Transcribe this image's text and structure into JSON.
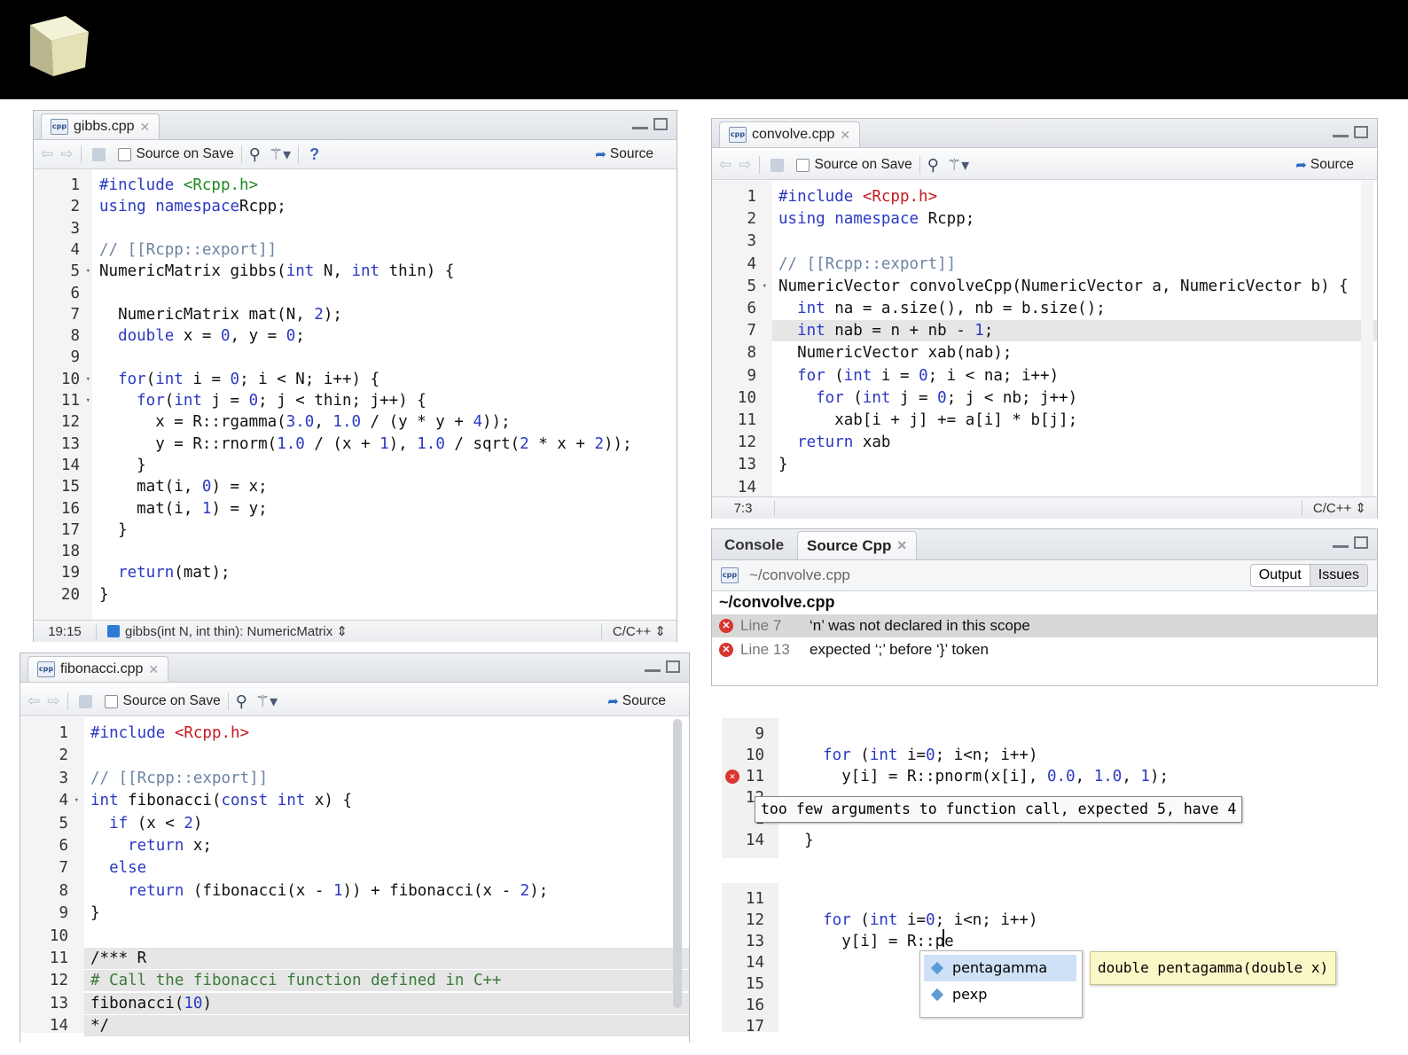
{
  "colors": {
    "keyword": "#2a39c3",
    "string_green": "#1b8a22",
    "string_red": "#c7191f",
    "comment": "#6b84a3"
  },
  "toolbar": {
    "source_on_save": "Source on Save",
    "source": "Source",
    "help": "?"
  },
  "gibbs": {
    "tab": "gibbs.cpp",
    "status": {
      "pos": "19:15",
      "fn": "gibbs(int N, int thin): NumericMatrix ⇕",
      "lang": "C/C++ ⇕"
    },
    "lines": [
      {
        "n": "1",
        "s": [
          [
            "pp",
            "#include "
          ],
          [
            "str",
            "<Rcpp.h>"
          ]
        ]
      },
      {
        "n": "2",
        "s": [
          [
            "kw",
            "using namespace"
          ],
          [
            "",
            "Rcpp;"
          ]
        ]
      },
      {
        "n": "3",
        "s": []
      },
      {
        "n": "4",
        "s": [
          [
            "cm",
            "// [[Rcpp::export]]"
          ]
        ]
      },
      {
        "n": "5",
        "f": true,
        "s": [
          [
            "",
            "NumericMatrix gibbs("
          ],
          [
            "kw",
            "int"
          ],
          [
            "",
            " N, "
          ],
          [
            "kw",
            "int"
          ],
          [
            "",
            " thin) {"
          ]
        ]
      },
      {
        "n": "6",
        "s": []
      },
      {
        "n": "7",
        "s": [
          [
            "",
            "  NumericMatrix mat(N, "
          ],
          [
            "num",
            "2"
          ],
          [
            "",
            ");"
          ]
        ]
      },
      {
        "n": "8",
        "s": [
          [
            "kw",
            "  double"
          ],
          [
            "",
            " x = "
          ],
          [
            "num",
            "0"
          ],
          [
            "",
            ", y = "
          ],
          [
            "num",
            "0"
          ],
          [
            "",
            ";"
          ]
        ]
      },
      {
        "n": "9",
        "s": []
      },
      {
        "n": "10",
        "f": true,
        "s": [
          [
            "kw",
            "  for"
          ],
          [
            "",
            "("
          ],
          [
            "kw",
            "int"
          ],
          [
            "",
            " i = "
          ],
          [
            "num",
            "0"
          ],
          [
            "",
            "; i < N; i++) {"
          ]
        ]
      },
      {
        "n": "11",
        "f": true,
        "s": [
          [
            "kw",
            "    for"
          ],
          [
            "",
            "("
          ],
          [
            "kw",
            "int"
          ],
          [
            "",
            " j = "
          ],
          [
            "num",
            "0"
          ],
          [
            "",
            "; j < thin; j++) {"
          ]
        ]
      },
      {
        "n": "12",
        "s": [
          [
            "",
            "      x = R::rgamma("
          ],
          [
            "num",
            "3.0"
          ],
          [
            "",
            ", "
          ],
          [
            "num",
            "1.0"
          ],
          [
            "",
            " / (y * y + "
          ],
          [
            "num",
            "4"
          ],
          [
            "",
            "));"
          ]
        ]
      },
      {
        "n": "13",
        "s": [
          [
            "",
            "      y = R::rnorm("
          ],
          [
            "num",
            "1.0"
          ],
          [
            "",
            " / (x + "
          ],
          [
            "num",
            "1"
          ],
          [
            "",
            "), "
          ],
          [
            "num",
            "1.0"
          ],
          [
            "",
            " / sqrt("
          ],
          [
            "num",
            "2"
          ],
          [
            "",
            " * x + "
          ],
          [
            "num",
            "2"
          ],
          [
            "",
            "));"
          ]
        ]
      },
      {
        "n": "14",
        "s": [
          [
            "",
            "    }"
          ]
        ]
      },
      {
        "n": "15",
        "s": [
          [
            "",
            "    mat(i, "
          ],
          [
            "num",
            "0"
          ],
          [
            "",
            ") = x;"
          ]
        ]
      },
      {
        "n": "16",
        "s": [
          [
            "",
            "    mat(i, "
          ],
          [
            "num",
            "1"
          ],
          [
            "",
            ") = y;"
          ]
        ]
      },
      {
        "n": "17",
        "s": [
          [
            "",
            "  }"
          ]
        ]
      },
      {
        "n": "18",
        "s": []
      },
      {
        "n": "19",
        "s": [
          [
            "kw",
            "  return"
          ],
          [
            "",
            "(mat);"
          ]
        ]
      },
      {
        "n": "20",
        "s": [
          [
            "",
            "}"
          ]
        ]
      }
    ]
  },
  "convolve": {
    "tab": "convolve.cpp",
    "status": {
      "pos": "7:3",
      "lang": "C/C++ ⇕"
    },
    "lines": [
      {
        "n": "1",
        "s": [
          [
            "kw",
            "#include "
          ],
          [
            "strr",
            "<Rcpp.h>"
          ]
        ]
      },
      {
        "n": "2",
        "s": [
          [
            "kw",
            "using namespace"
          ],
          [
            "",
            " Rcpp;"
          ]
        ]
      },
      {
        "n": "3",
        "s": []
      },
      {
        "n": "4",
        "s": [
          [
            "cm",
            "// [[Rcpp::export]]"
          ]
        ]
      },
      {
        "n": "5",
        "f": true,
        "s": [
          [
            "",
            "NumericVector convolveCpp(NumericVector a, NumericVector b) {"
          ]
        ]
      },
      {
        "n": "6",
        "s": [
          [
            "kw",
            "  int"
          ],
          [
            "",
            " na = a.size(), nb = b.size();"
          ]
        ]
      },
      {
        "n": "7",
        "hl": true,
        "s": [
          [
            "kw",
            "  int"
          ],
          [
            "",
            " nab = n + nb - "
          ],
          [
            "num",
            "1"
          ],
          [
            "",
            ";"
          ]
        ]
      },
      {
        "n": "8",
        "s": [
          [
            "",
            "  NumericVector xab(nab);"
          ]
        ]
      },
      {
        "n": "9",
        "s": [
          [
            "kw",
            "  for"
          ],
          [
            "",
            " ("
          ],
          [
            "kw",
            "int"
          ],
          [
            "",
            " i = "
          ],
          [
            "num",
            "0"
          ],
          [
            "",
            "; i < na; i++)"
          ]
        ]
      },
      {
        "n": "10",
        "s": [
          [
            "kw",
            "    for"
          ],
          [
            "",
            " ("
          ],
          [
            "kw",
            "int"
          ],
          [
            "",
            " j = "
          ],
          [
            "num",
            "0"
          ],
          [
            "",
            "; j < nb; j++)"
          ]
        ]
      },
      {
        "n": "11",
        "s": [
          [
            "",
            "      xab[i + j] += a[i] * b[j];"
          ]
        ]
      },
      {
        "n": "12",
        "s": [
          [
            "kw",
            "  return"
          ],
          [
            "",
            " xab"
          ]
        ]
      },
      {
        "n": "13",
        "s": [
          [
            "",
            "}"
          ]
        ]
      },
      {
        "n": "14",
        "s": []
      }
    ]
  },
  "console": {
    "tabs": [
      "Console",
      "Source Cpp"
    ],
    "path": "~/convolve.cpp",
    "buttons": [
      "Output",
      "Issues"
    ],
    "file": "~/convolve.cpp",
    "issues": [
      {
        "line": "Line 7",
        "msg": "‘n’ was not declared in this scope"
      },
      {
        "line": "Line 13",
        "msg": "expected ‘;’ before ‘}’ token"
      }
    ]
  },
  "fibonacci": {
    "tab": "fibonacci.cpp",
    "lines": [
      {
        "n": "1",
        "s": [
          [
            "kw",
            "#include "
          ],
          [
            "strr",
            "<Rcpp.h>"
          ]
        ]
      },
      {
        "n": "2",
        "s": []
      },
      {
        "n": "3",
        "s": [
          [
            "cm",
            "// [[Rcpp::export]]"
          ]
        ]
      },
      {
        "n": "4",
        "f": true,
        "s": [
          [
            "kw",
            "int"
          ],
          [
            "",
            " fibonacci("
          ],
          [
            "kw",
            "const int"
          ],
          [
            "",
            " x) {"
          ]
        ]
      },
      {
        "n": "5",
        "s": [
          [
            "kw",
            "  if"
          ],
          [
            "",
            " (x < "
          ],
          [
            "num",
            "2"
          ],
          [
            "",
            ")"
          ]
        ]
      },
      {
        "n": "6",
        "s": [
          [
            "kw",
            "    return"
          ],
          [
            "",
            " x;"
          ]
        ]
      },
      {
        "n": "7",
        "s": [
          [
            "kw",
            "  else"
          ]
        ]
      },
      {
        "n": "8",
        "s": [
          [
            "kw",
            "    return"
          ],
          [
            "",
            " (fibonacci(x - "
          ],
          [
            "num",
            "1"
          ],
          [
            "",
            ")) + fibonacci(x - "
          ],
          [
            "num",
            "2"
          ],
          [
            "",
            ");"
          ]
        ]
      },
      {
        "n": "9",
        "s": [
          [
            "",
            "}"
          ]
        ]
      },
      {
        "n": "10",
        "s": []
      },
      {
        "n": "11",
        "hl": true,
        "s": [
          [
            "",
            "/*** R"
          ]
        ]
      },
      {
        "n": "12",
        "hl": true,
        "s": [
          [
            "cmg",
            "# Call the fibonacci function defined in C++"
          ]
        ]
      },
      {
        "n": "13",
        "hl": true,
        "s": [
          [
            "",
            "fibonacci("
          ],
          [
            "num",
            "10"
          ],
          [
            "",
            ")"
          ]
        ]
      },
      {
        "n": "14",
        "hl": true,
        "s": [
          [
            "",
            "*/"
          ]
        ]
      }
    ]
  },
  "snippet1": {
    "lines": [
      {
        "n": "9",
        "s": []
      },
      {
        "n": "10",
        "s": [
          [
            "kw",
            "    for"
          ],
          [
            "",
            " ("
          ],
          [
            "kw",
            "int"
          ],
          [
            "",
            " i="
          ],
          [
            "num",
            "0"
          ],
          [
            "",
            "; i<n; i++)"
          ]
        ]
      },
      {
        "n": "11",
        "e": true,
        "s": [
          [
            "",
            "      y[i] = R::pnorm(x[i], "
          ],
          [
            "num",
            "0.0"
          ],
          [
            "",
            ", "
          ],
          [
            "num",
            "1.0"
          ],
          [
            "",
            ", "
          ],
          [
            "num",
            "1"
          ],
          [
            "",
            ");"
          ]
        ]
      },
      {
        "n": "12",
        "s": []
      },
      {
        "n": "1",
        "s": []
      },
      {
        "n": "14",
        "s": [
          [
            "",
            "  }"
          ]
        ]
      }
    ],
    "tooltip": "too few arguments to function call, expected 5, have 4"
  },
  "snippet2": {
    "lines": [
      {
        "n": "11",
        "s": []
      },
      {
        "n": "12",
        "s": [
          [
            "kw",
            "    for"
          ],
          [
            "",
            " ("
          ],
          [
            "kw",
            "int"
          ],
          [
            "",
            " i="
          ],
          [
            "num",
            "0"
          ],
          [
            "",
            "; i<n; i++)"
          ]
        ]
      },
      {
        "n": "13",
        "s": [
          [
            "",
            "      y[i] = R::pe"
          ]
        ]
      },
      {
        "n": "14",
        "s": []
      },
      {
        "n": "15",
        "s": []
      },
      {
        "n": "16",
        "s": []
      },
      {
        "n": "17",
        "s": []
      }
    ],
    "completions": [
      "pentagamma",
      "pexp"
    ],
    "signature": "double pentagamma(double x)"
  }
}
